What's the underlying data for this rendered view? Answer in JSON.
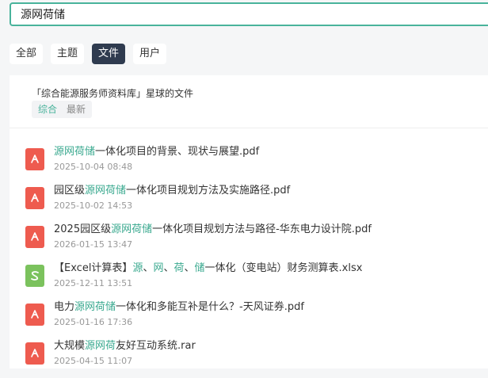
{
  "search": {
    "value": "源网荷储"
  },
  "tabs": [
    {
      "label": "全部",
      "active": false
    },
    {
      "label": "主题",
      "active": false
    },
    {
      "label": "文件",
      "active": true
    },
    {
      "label": "用户",
      "active": false
    }
  ],
  "scope_text": "「综合能源服务师资料库」星球的文件",
  "sort": [
    {
      "label": "综合",
      "active": true
    },
    {
      "label": "最新",
      "active": false
    }
  ],
  "files": [
    {
      "icon": "pdf-file-icon",
      "type": "pdf",
      "parts": [
        {
          "text": "源网荷储",
          "hl": true
        },
        {
          "text": "一体化项目的背景、现状与展望.pdf",
          "hl": false
        }
      ],
      "time": "2025-10-04 08:48"
    },
    {
      "icon": "pdf-file-icon",
      "type": "pdf",
      "parts": [
        {
          "text": "园区级",
          "hl": false
        },
        {
          "text": "源网荷储",
          "hl": true
        },
        {
          "text": "一体化项目规划方法及实施路径.pdf",
          "hl": false
        }
      ],
      "time": "2025-10-02 14:53"
    },
    {
      "icon": "pdf-file-icon",
      "type": "pdf",
      "parts": [
        {
          "text": "2025园区级",
          "hl": false
        },
        {
          "text": "源网荷储",
          "hl": true
        },
        {
          "text": "一体化项目规划方法与路径-华东电力设计院.pdf",
          "hl": false
        }
      ],
      "time": "2026-01-15 13:47"
    },
    {
      "icon": "spreadsheet-file-icon",
      "type": "xls",
      "parts": [
        {
          "text": "【Excel计算表】",
          "hl": false
        },
        {
          "text": "源",
          "hl": true
        },
        {
          "text": "、",
          "hl": false
        },
        {
          "text": "网",
          "hl": true
        },
        {
          "text": "、",
          "hl": false
        },
        {
          "text": "荷",
          "hl": true
        },
        {
          "text": "、",
          "hl": false
        },
        {
          "text": "储",
          "hl": true
        },
        {
          "text": "一体化（变电站）财务测算表.xlsx",
          "hl": false
        }
      ],
      "time": "2025-12-11 13:51"
    },
    {
      "icon": "pdf-file-icon",
      "type": "pdf",
      "parts": [
        {
          "text": "电力",
          "hl": false
        },
        {
          "text": "源网荷储",
          "hl": true
        },
        {
          "text": "一体化和多能互补是什么？-天风证券.pdf",
          "hl": false
        }
      ],
      "time": "2025-01-16 17:36"
    },
    {
      "icon": "archive-file-icon",
      "type": "rar",
      "parts": [
        {
          "text": "大规模",
          "hl": false
        },
        {
          "text": "源网荷",
          "hl": true
        },
        {
          "text": "友好互动系统.rar",
          "hl": false
        }
      ],
      "time": "2025-04-15 11:07"
    }
  ],
  "colors": {
    "accent": "#49b39b",
    "highlight": "#3aa98f",
    "active_tab": "#2f3b4f",
    "pdf": "#ee5b4f",
    "xls": "#7bc25d"
  }
}
